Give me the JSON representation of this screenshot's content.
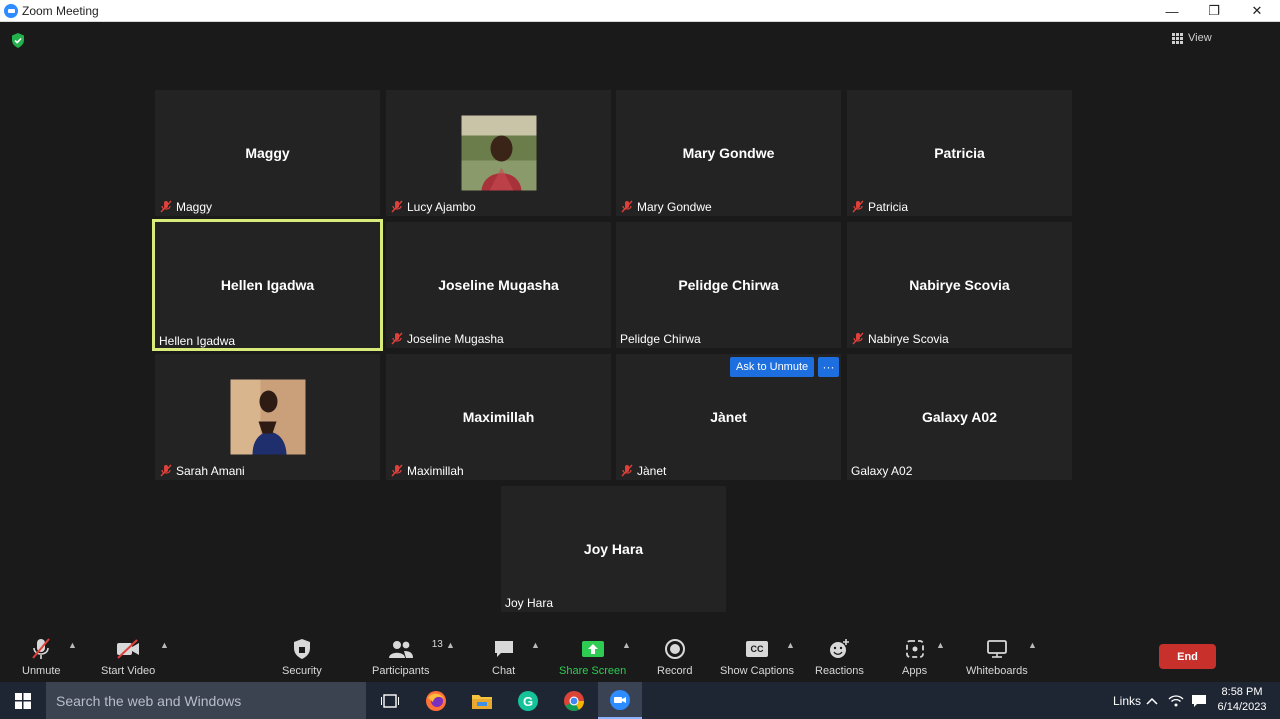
{
  "window": {
    "title": "Zoom Meeting",
    "minimize": "—",
    "restore": "❐",
    "close": "✕"
  },
  "header": {
    "view_label": "View"
  },
  "tiles": [
    {
      "name": "Maggy",
      "label": "Maggy",
      "muted": true,
      "has_photo": false
    },
    {
      "name": "",
      "label": "Lucy Ajambo",
      "muted": true,
      "has_photo": true
    },
    {
      "name": "Mary Gondwe",
      "label": "Mary Gondwe",
      "muted": true,
      "has_photo": false
    },
    {
      "name": "Patricia",
      "label": "Patricia",
      "muted": true,
      "has_photo": false
    },
    {
      "name": "Hellen Igadwa",
      "label": "Hellen Igadwa",
      "muted": false,
      "has_photo": false,
      "active_speaker": true
    },
    {
      "name": "Joseline Mugasha",
      "label": "Joseline Mugasha",
      "muted": true,
      "has_photo": false
    },
    {
      "name": "Pelidge Chirwa",
      "label": "Pelidge Chirwa",
      "muted": false,
      "has_photo": false
    },
    {
      "name": "Nabirye Scovia",
      "label": "Nabirye Scovia",
      "muted": true,
      "has_photo": false
    },
    {
      "name": "",
      "label": "Sarah Amani",
      "muted": true,
      "has_photo": true
    },
    {
      "name": "Maximillah",
      "label": "Maximillah",
      "muted": true,
      "has_photo": false
    },
    {
      "name": "Jànet",
      "label": "Jànet",
      "muted": true,
      "has_photo": false
    },
    {
      "name": "Galaxy A02",
      "label": "Galaxy A02",
      "muted": false,
      "has_photo": false
    },
    {
      "name": "Joy Hara",
      "label": "Joy Hara",
      "muted": false,
      "has_photo": false
    }
  ],
  "hover_actions": {
    "ask_to_unmute": "Ask to Unmute",
    "more": "···"
  },
  "toolbar": {
    "unmute": "Unmute",
    "start_video": "Start Video",
    "security": "Security",
    "participants": "Participants",
    "participants_count": "13",
    "chat": "Chat",
    "share_screen": "Share Screen",
    "record": "Record",
    "show_captions": "Show Captions",
    "captions_badge": "CC",
    "reactions": "Reactions",
    "apps": "Apps",
    "whiteboards": "Whiteboards",
    "end": "End"
  },
  "taskbar": {
    "search_placeholder": "Search the web and Windows",
    "links": "Links",
    "time": "8:58 PM",
    "date": "6/14/2023"
  },
  "colors": {
    "accent": "#2d8cff",
    "share_green": "#2ecc52",
    "end_red": "#c8312b",
    "active_border": "#d9ec7a"
  }
}
